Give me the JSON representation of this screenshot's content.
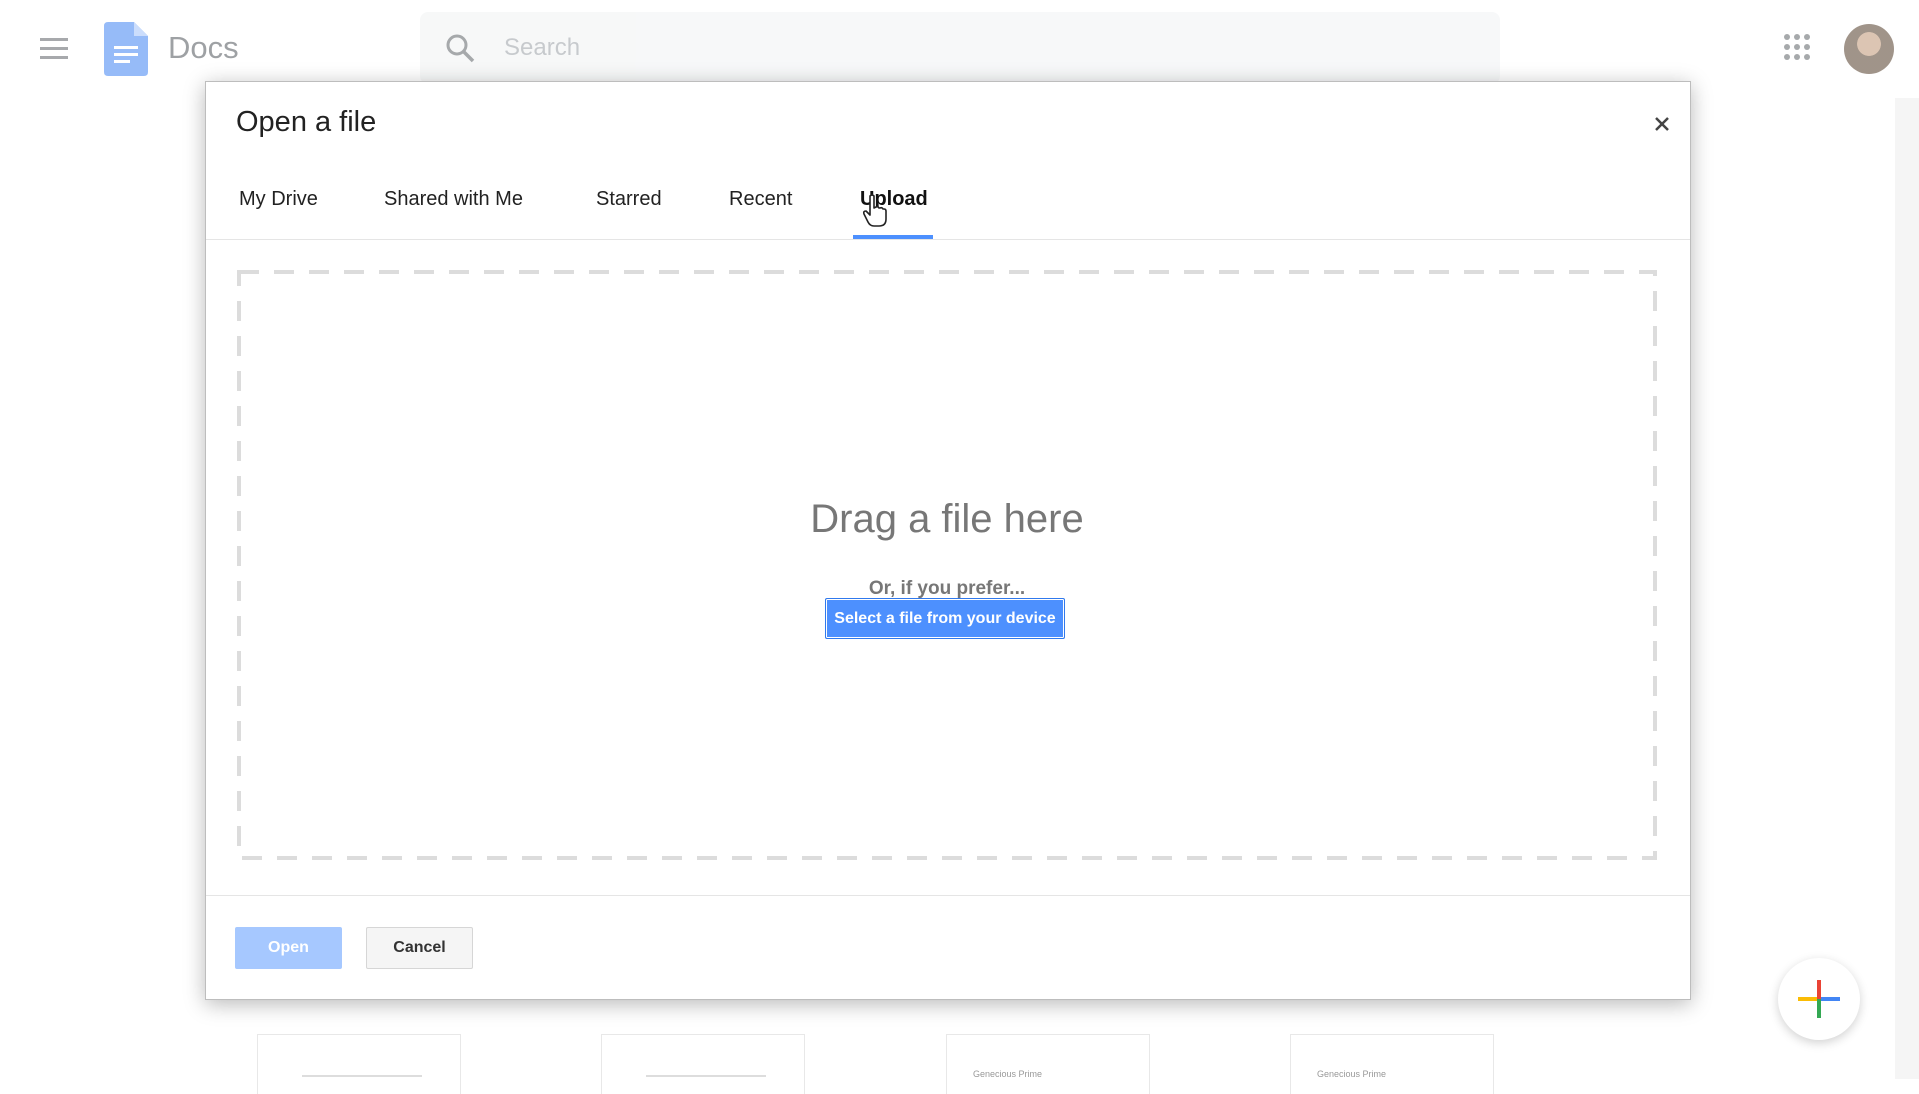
{
  "header": {
    "app_title": "Docs",
    "menu_icon": "hamburger-menu-icon",
    "logo_icon": "docs-logo-icon",
    "search_placeholder": "Search",
    "search_icon": "search-icon",
    "apps_icon": "apps-grid-icon",
    "avatar": "user-avatar"
  },
  "dialog": {
    "title": "Open a file",
    "close_icon": "close-icon",
    "tabs": [
      {
        "label": "My Drive",
        "active": false
      },
      {
        "label": "Shared with Me",
        "active": false
      },
      {
        "label": "Starred",
        "active": false
      },
      {
        "label": "Recent",
        "active": false
      },
      {
        "label": "Upload",
        "active": true
      }
    ],
    "drop_zone": {
      "title": "Drag a file here",
      "subtitle": "Or, if you prefer...",
      "select_button": "Select a file from your device"
    },
    "footer": {
      "open_label": "Open",
      "cancel_label": "Cancel"
    }
  },
  "background_docs": [
    {
      "label": ""
    },
    {
      "label": ""
    },
    {
      "label": "Genecious Prime"
    },
    {
      "label": "Genecious Prime"
    }
  ],
  "colors": {
    "accent": "#4d90fe",
    "open_disabled": "#a6c8ff",
    "tab_underline": "#4d90fe"
  }
}
